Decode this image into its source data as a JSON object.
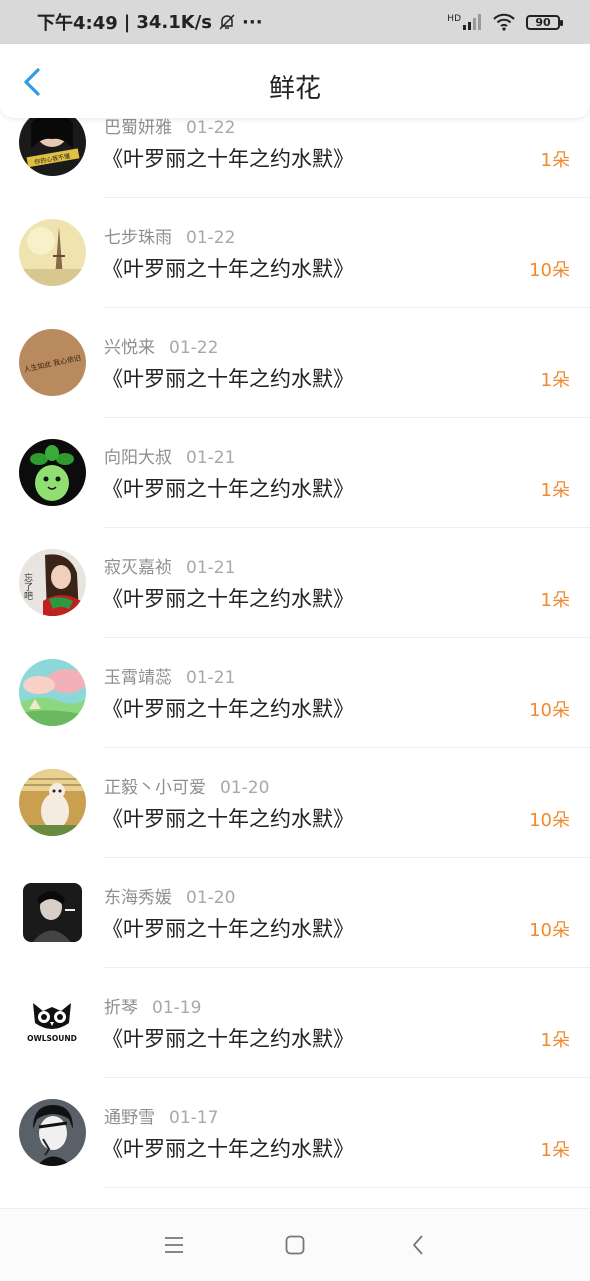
{
  "status_bar": {
    "time": "下午4:49",
    "separator": "|",
    "speed": "34.1K/s",
    "dots": "···",
    "hd": "HD",
    "battery": "90",
    "icons": [
      "bell-off-icon",
      "signal-icon",
      "wifi-icon",
      "battery-icon"
    ]
  },
  "header": {
    "title": "鲜花",
    "accent_color": "#2f9ae6",
    "icons": [
      "back-chevron-icon"
    ]
  },
  "count_color": "#f08a2c",
  "rows": [
    {
      "name": "巴蜀妍雅",
      "date": "01-22",
      "book": "《叶罗丽之十年之约水默》",
      "count": "1朵"
    },
    {
      "name": "七步珠雨",
      "date": "01-22",
      "book": "《叶罗丽之十年之约水默》",
      "count": "10朵"
    },
    {
      "name": "兴悦来",
      "date": "01-22",
      "book": "《叶罗丽之十年之约水默》",
      "count": "1朵"
    },
    {
      "name": "向阳大叔",
      "date": "01-21",
      "book": "《叶罗丽之十年之约水默》",
      "count": "1朵"
    },
    {
      "name": "寂灭嘉祯",
      "date": "01-21",
      "book": "《叶罗丽之十年之约水默》",
      "count": "1朵"
    },
    {
      "name": "玉霄靖蕊",
      "date": "01-21",
      "book": "《叶罗丽之十年之约水默》",
      "count": "10朵"
    },
    {
      "name": "正毅丶小可爱",
      "date": "01-20",
      "book": "《叶罗丽之十年之约水默》",
      "count": "10朵"
    },
    {
      "name": "东海秀媛",
      "date": "01-20",
      "book": "《叶罗丽之十年之约水默》",
      "count": "10朵"
    },
    {
      "name": "折琴",
      "date": "01-19",
      "book": "《叶罗丽之十年之约水默》",
      "count": "1朵"
    },
    {
      "name": "通野雪",
      "date": "01-17",
      "book": "《叶罗丽之十年之约水默》",
      "count": "1朵"
    }
  ],
  "avatar_texts": {
    "first": "你的心我不懂",
    "third": "人生如此 我心依旧",
    "fifth": "忘了吧",
    "ninth": "OWLSOUND"
  },
  "nav_bar": {
    "icons": [
      "menu-icon",
      "home-square-icon",
      "back-triangle-icon"
    ]
  }
}
